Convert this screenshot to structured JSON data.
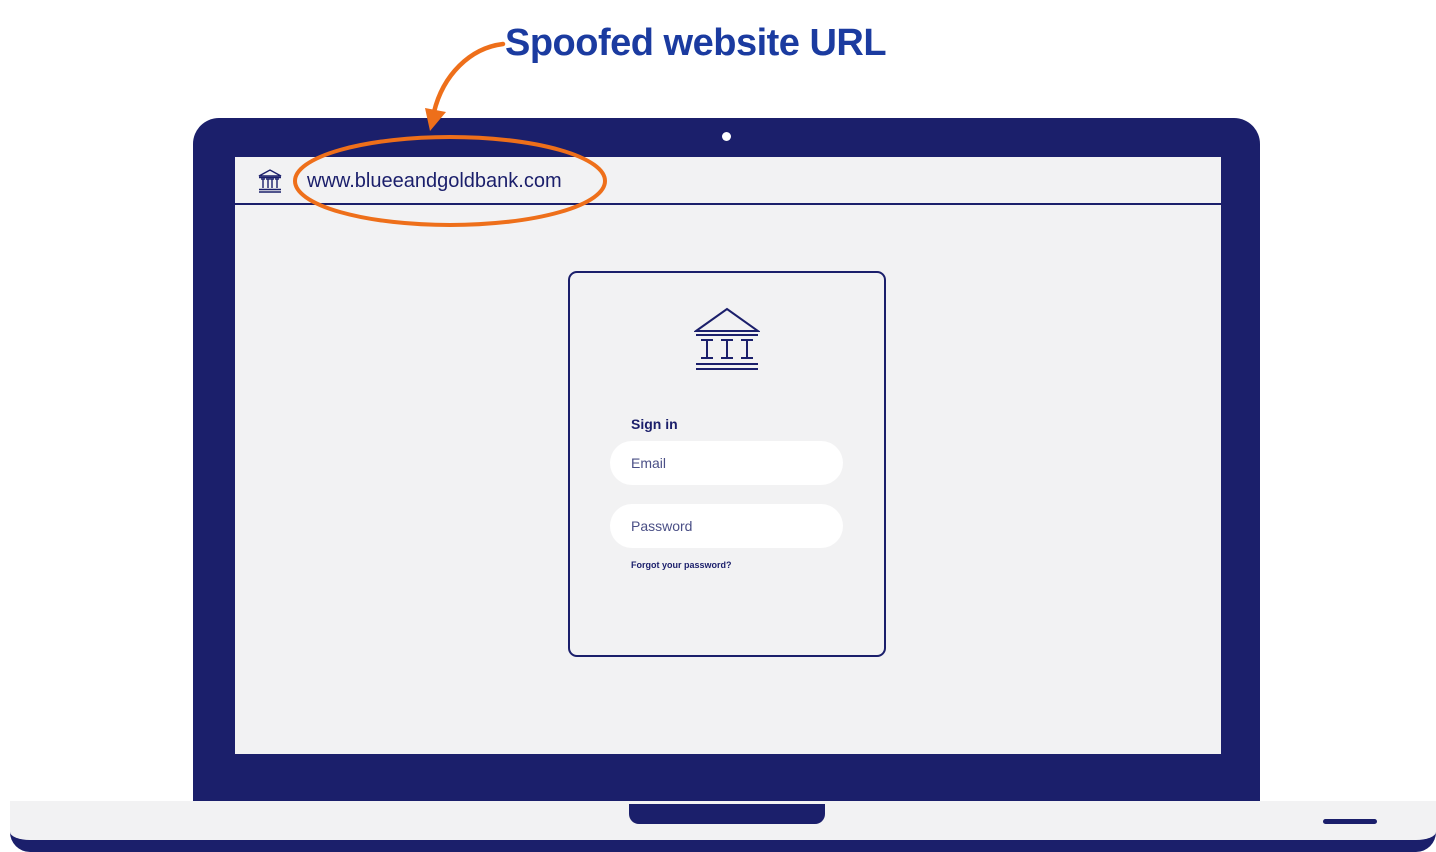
{
  "callout": {
    "text": "Spoofed website URL"
  },
  "browser": {
    "url": "www.blueeandgoldbank.com",
    "icon": "bank-building-icon"
  },
  "login": {
    "logo_icon": "bank-building-icon",
    "title": "Sign in",
    "email_placeholder": "Email",
    "password_placeholder": "Password",
    "forgot_password": "Forgot your password?"
  },
  "colors": {
    "laptop_navy": "#1b1f6b",
    "callout_blue": "#1b3ba0",
    "highlight_orange": "#ee6f1a",
    "screen_bg": "#f2f2f3"
  }
}
